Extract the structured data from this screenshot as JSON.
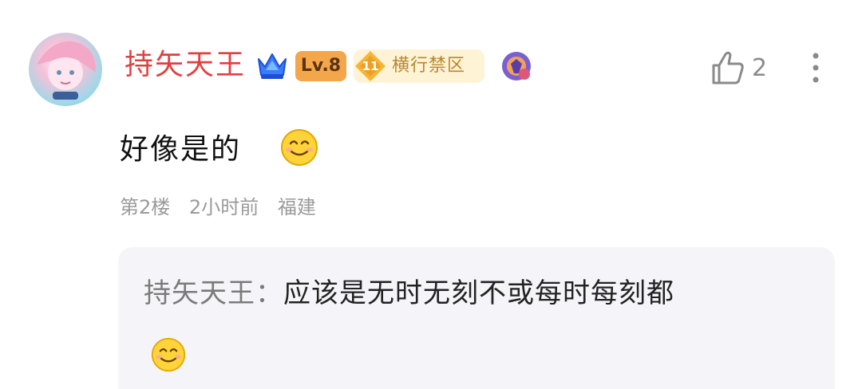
{
  "comment": {
    "username": "持矢天王",
    "level_badge": "Lv.8",
    "fan_badge": {
      "number": "11",
      "label": "横行禁区"
    },
    "like_count": "2",
    "text": "好像是的",
    "floor": "第2楼",
    "time": "2小时前",
    "location": "福建"
  },
  "reply": {
    "username": "持矢天王",
    "separator": "：",
    "text": "应该是无时无刻不或每时每刻都"
  },
  "colors": {
    "username": "#e04040",
    "level_badge_bg": "#f3a64a",
    "fan_badge_bg": "#fff3d6",
    "fan_badge_text": "#b7872f",
    "reply_bg": "#f5f5f9",
    "meta_text": "#9a9a9a"
  },
  "icons": {
    "avatar": "avatar-image",
    "crown": "crown-icon",
    "like": "thumbs-up-icon",
    "more": "more-vertical-icon",
    "emoji": "smile-emoji-icon",
    "decoration": "decoration-badge-icon"
  }
}
